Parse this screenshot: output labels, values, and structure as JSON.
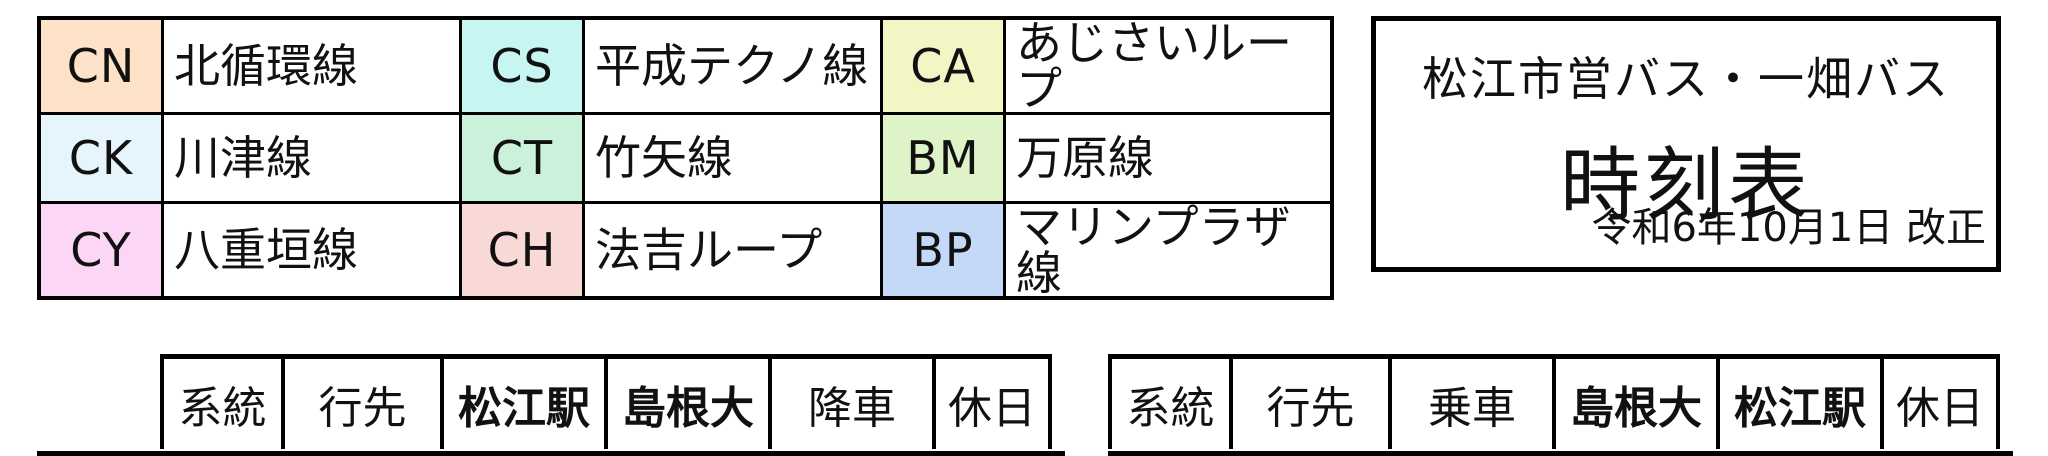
{
  "legend": {
    "rows": [
      [
        {
          "code": "CN",
          "name": "北循環線",
          "color": "#fde2c8"
        },
        {
          "code": "CS",
          "name": "平成テクノ線",
          "color": "#c6f5f2"
        },
        {
          "code": "CA",
          "name": "あじさいループ",
          "color": "#f3f6c4"
        }
      ],
      [
        {
          "code": "CK",
          "name": "川津線",
          "color": "#e6f4fb"
        },
        {
          "code": "CT",
          "name": "竹矢線",
          "color": "#cbf1da"
        },
        {
          "code": "BM",
          "name": "万原線",
          "color": "#def3c8"
        }
      ],
      [
        {
          "code": "CY",
          "name": "八重垣線",
          "color": "#fbd7f5"
        },
        {
          "code": "CH",
          "name": "法吉ループ",
          "color": "#f9d9d6"
        },
        {
          "code": "BP",
          "name": "マリンプラザ線",
          "color": "#c4d8f8"
        }
      ]
    ]
  },
  "title": {
    "operator": "松江市営バス・一畑バス",
    "main": "時刻表",
    "revision": "令和6年10月1日 改正"
  },
  "tables": {
    "left": [
      "系統",
      "行先",
      "松江駅",
      "島根大",
      "降車",
      "休日"
    ],
    "right": [
      "系統",
      "行先",
      "乗車",
      "島根大",
      "松江駅",
      "休日"
    ]
  }
}
